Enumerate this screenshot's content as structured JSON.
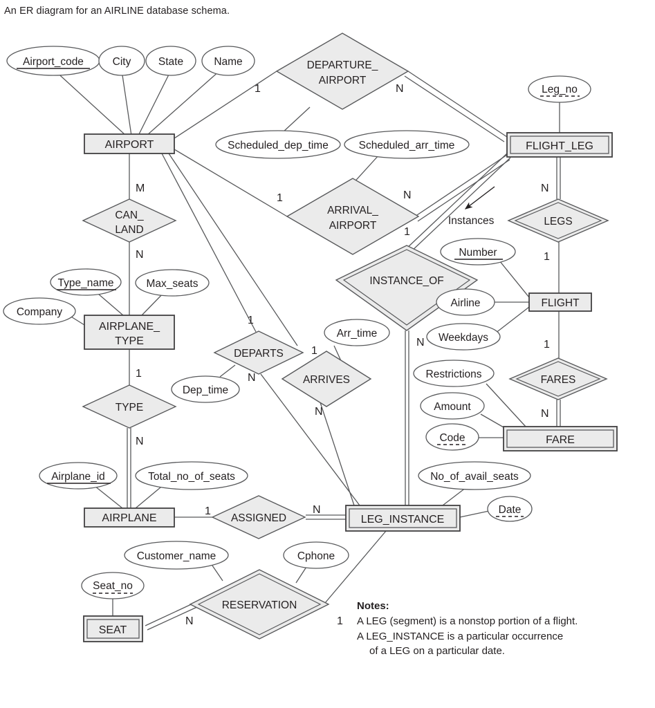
{
  "caption": "An ER diagram for an AIRLINE database schema.",
  "colors": {
    "fill": "#ebebeb",
    "stroke": "#58595b",
    "stroke_dark": "#414042",
    "text": "#231f20",
    "background": "#ffffff"
  },
  "diagram": {
    "type": "entity-relationship-diagram",
    "title": "AIRLINE database schema",
    "entities": [
      {
        "id": "airport",
        "label": "AIRPORT",
        "weak": false
      },
      {
        "id": "flight_leg",
        "label": "FLIGHT_LEG",
        "weak": true
      },
      {
        "id": "flight",
        "label": "FLIGHT",
        "weak": false
      },
      {
        "id": "fare",
        "label": "FARE",
        "weak": true
      },
      {
        "id": "leg_instance",
        "label": "LEG_INSTANCE",
        "weak": true
      },
      {
        "id": "airplane_type",
        "label": "AIRPLANE_\nTYPE",
        "weak": false
      },
      {
        "id": "airplane",
        "label": "AIRPLANE",
        "weak": false
      },
      {
        "id": "seat",
        "label": "SEAT",
        "weak": true
      }
    ],
    "entity_labels": {
      "airport": "AIRPORT",
      "flight_leg": "FLIGHT_LEG",
      "flight": "FLIGHT",
      "fare": "FARE",
      "leg_instance": "LEG_INSTANCE",
      "airplane_type_line1": "AIRPLANE_",
      "airplane_type_line2": "TYPE",
      "airplane": "AIRPLANE",
      "seat": "SEAT"
    },
    "relationships": [
      {
        "id": "departure_airport",
        "label": "DEPARTURE_\nAIRPORT",
        "identifying": false
      },
      {
        "id": "arrival_airport",
        "label": "ARRIVAL_\nAIRPORT",
        "identifying": false
      },
      {
        "id": "legs",
        "label": "LEGS",
        "identifying": true
      },
      {
        "id": "instance_of",
        "label": "INSTANCE_OF",
        "identifying": true
      },
      {
        "id": "fares",
        "label": "FARES",
        "identifying": true
      },
      {
        "id": "can_land",
        "label": "CAN_\nLAND",
        "identifying": false
      },
      {
        "id": "type",
        "label": "TYPE",
        "identifying": false
      },
      {
        "id": "departs",
        "label": "DEPARTS",
        "identifying": false
      },
      {
        "id": "arrives",
        "label": "ARRIVES",
        "identifying": false
      },
      {
        "id": "assigned",
        "label": "ASSIGNED",
        "identifying": false
      },
      {
        "id": "reservation",
        "label": "RESERVATION",
        "identifying": true
      }
    ],
    "relationship_labels": {
      "departure_airport_line1": "DEPARTURE_",
      "departure_airport_line2": "AIRPORT",
      "arrival_airport_line1": "ARRIVAL_",
      "arrival_airport_line2": "AIRPORT",
      "legs": "LEGS",
      "instance_of": "INSTANCE_OF",
      "fares": "FARES",
      "can_land_line1": "CAN_",
      "can_land_line2": "LAND",
      "type": "TYPE",
      "departs": "DEPARTS",
      "arrives": "ARRIVES",
      "assigned": "ASSIGNED",
      "reservation": "RESERVATION"
    },
    "attributes": {
      "airport_code": "Airport_code",
      "city": "City",
      "state": "State",
      "name": "Name",
      "scheduled_dep_time": "Scheduled_dep_time",
      "scheduled_arr_time": "Scheduled_arr_time",
      "leg_no": "Leg_no",
      "number": "Number",
      "airline": "Airline",
      "weekdays": "Weekdays",
      "restrictions": "Restrictions",
      "amount": "Amount",
      "code": "Code",
      "no_of_avail_seats": "No_of_avail_seats",
      "date": "Date",
      "arr_time": "Arr_time",
      "dep_time": "Dep_time",
      "type_name": "Type_name",
      "max_seats": "Max_seats",
      "company": "Company",
      "airplane_id": "Airplane_id",
      "total_no_of_seats": "Total_no_of_seats",
      "seat_no": "Seat_no",
      "customer_name": "Customer_name",
      "cphone": "Cphone"
    },
    "attribute_keys": {
      "airport_code": "key",
      "leg_no": "partial-key",
      "number": "key",
      "code": "partial-key",
      "date": "partial-key",
      "type_name": "key",
      "airplane_id": "key",
      "seat_no": "partial-key"
    },
    "cardinalities": {
      "airport_departure": "1",
      "departure_flightleg": "N",
      "airport_arrival": "1",
      "arrival_flightleg": "N",
      "flightleg_legs": "N",
      "legs_flight": "1",
      "flightleg_instanceof": "1",
      "instanceof_leginstance": "N",
      "flight_fares": "1",
      "fares_fare": "N",
      "airport_canland": "M",
      "canland_airplanetype": "N",
      "airplanetype_type": "1",
      "type_airplane": "N",
      "airport_departs": "1",
      "departs_leginstance": "N",
      "airport_arrives": "1",
      "arrives_leginstance": "N",
      "airplane_assigned": "1",
      "assigned_leginstance": "N",
      "seat_reservation": "N",
      "reservation_leginstance": "1"
    },
    "annotations": {
      "instances": "Instances"
    }
  },
  "notes": {
    "title": "Notes:",
    "line1": "A LEG (segment) is a nonstop portion of a flight.",
    "line2": "A LEG_INSTANCE is a particular occurrence",
    "line3": "of a LEG on a particular date."
  }
}
